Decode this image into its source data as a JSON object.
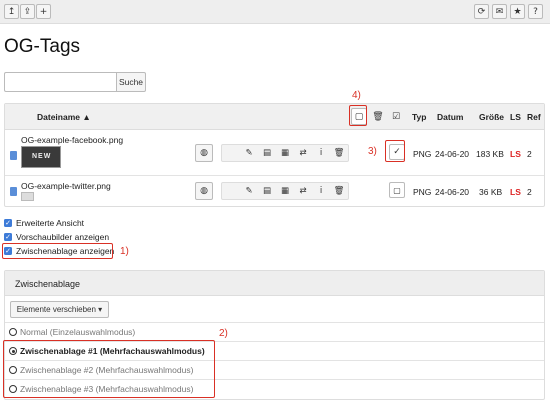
{
  "toolbar": {
    "left_icons": [
      "upload-level-icon",
      "upload-file-icon",
      "add-icon"
    ],
    "left_glyphs": [
      "↥",
      "⇪",
      "+"
    ],
    "right_icons": [
      "refresh-icon",
      "mail-icon",
      "star-icon",
      "help-icon"
    ],
    "right_glyphs": [
      "⟳",
      "✉",
      "★",
      "?"
    ]
  },
  "page_title": "OG-Tags",
  "search": {
    "value": "",
    "placeholder": "",
    "button_label": "Suche"
  },
  "table": {
    "columns": {
      "name": "Dateiname ▲",
      "type": "Typ",
      "date": "Datum",
      "size": "Größe",
      "ls": "LS",
      "ref": "Ref"
    },
    "rows": [
      {
        "name": "OG-example-facebook.png",
        "type": "PNG",
        "date": "24-06-20",
        "size": "183 KB",
        "ls": "LS",
        "ref": "2",
        "checked": true
      },
      {
        "name": "OG-example-twitter.png",
        "type": "PNG",
        "date": "24-06-20",
        "size": "36 KB",
        "ls": "LS",
        "ref": "2",
        "checked": false
      }
    ],
    "thumb_text": "NEW"
  },
  "options": [
    {
      "label": "Erweiterte Ansicht",
      "checked": true
    },
    {
      "label": "Vorschaubilder anzeigen",
      "checked": true
    },
    {
      "label": "Zwischenablage anzeigen",
      "checked": true
    }
  ],
  "clipboard": {
    "title": "Zwischenablage",
    "dropdown_label": "Elemente verschieben ▾",
    "modes": [
      {
        "label": "Normal (Einzelauswahlmodus)",
        "selected": false
      },
      {
        "label": "Zwischenablage #1 (Mehrfachauswahlmodus)",
        "selected": true
      },
      {
        "label": "Zwischenablage #2 (Mehrfachauswahlmodus)",
        "selected": false
      },
      {
        "label": "Zwischenablage #3 (Mehrfachauswahlmodus)",
        "selected": false
      }
    ]
  },
  "annotations": {
    "a1": "1)",
    "a2": "2)",
    "a3": "3)",
    "a4": "4)"
  },
  "colors": {
    "accent_red": "#d93025",
    "checkbox_blue": "#3d7bd8",
    "file_icon_blue": "#5a8ed8"
  }
}
